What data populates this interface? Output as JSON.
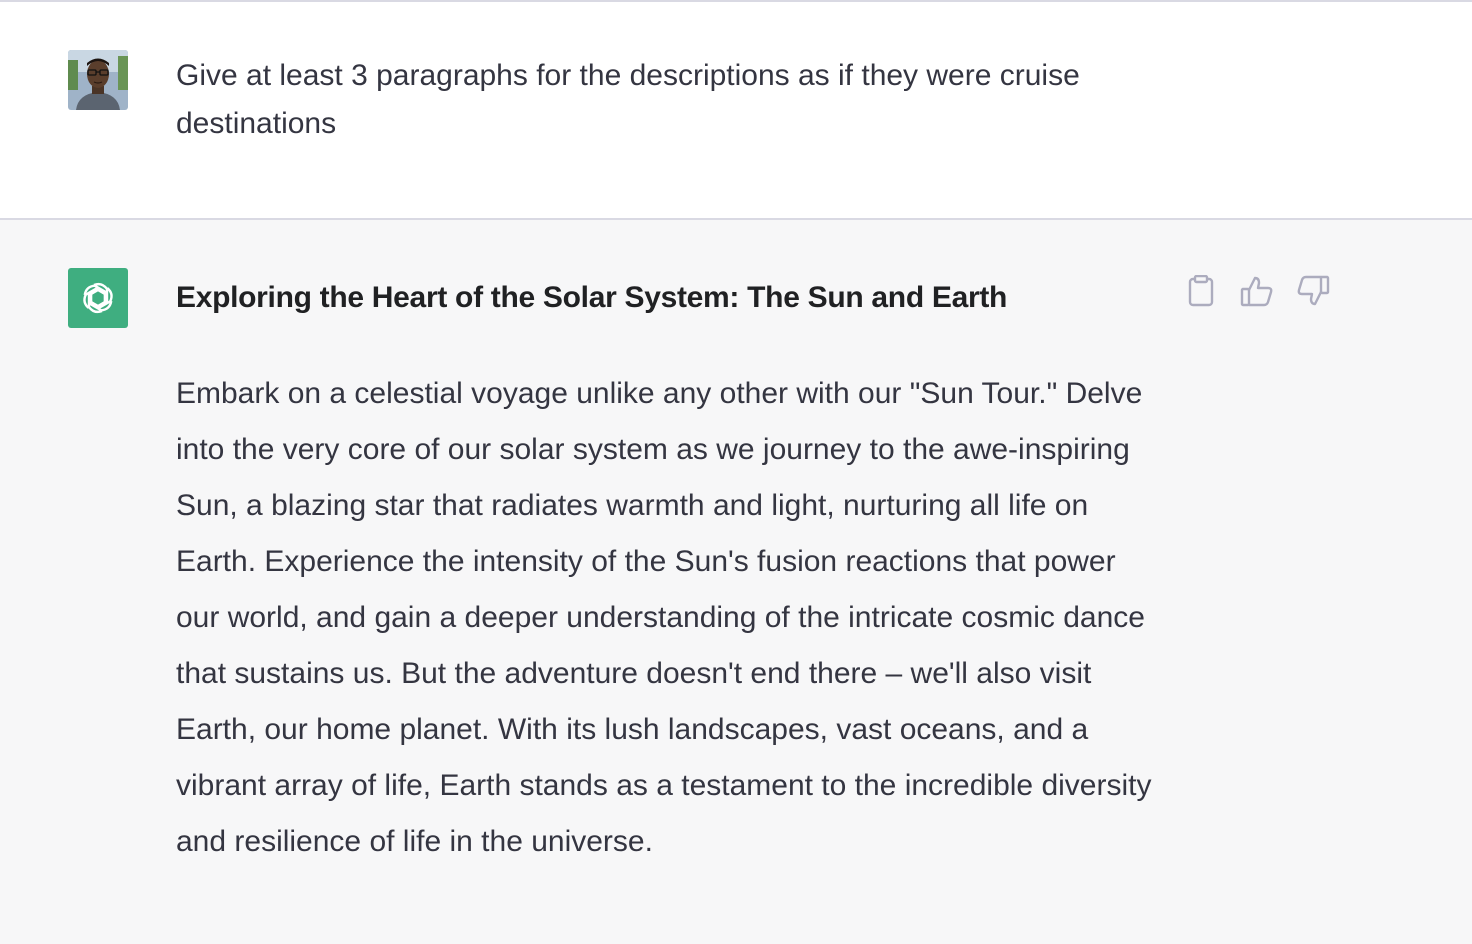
{
  "conversation": {
    "user_message": {
      "avatar_icon": "user-photo-avatar",
      "text": "Give at least 3 paragraphs for the descriptions as if they were cruise destinations"
    },
    "assistant_message": {
      "avatar_icon": "openai-logo-icon",
      "avatar_color": "#3fae80",
      "title": "Exploring the Heart of the Solar System: The Sun and Earth",
      "paragraphs": [
        "Embark on a celestial voyage unlike any other with our \"Sun Tour.\" Delve into the very core of our solar system as we journey to the awe-inspiring Sun, a blazing star that radiates warmth and light, nurturing all life on Earth. Experience the intensity of the Sun's fusion reactions that power our world, and gain a deeper understanding of the intricate cosmic dance that sustains us. But the adventure doesn't end there – we'll also visit Earth, our home planet. With its lush landscapes, vast oceans, and a vibrant array of life, Earth stands as a testament to the incredible diversity and resilience of life in the universe."
      ],
      "actions": [
        {
          "name": "copy",
          "icon": "clipboard-icon"
        },
        {
          "name": "thumbs-up",
          "icon": "thumbs-up-icon"
        },
        {
          "name": "thumbs-down",
          "icon": "thumbs-down-icon"
        }
      ]
    }
  },
  "colors": {
    "user_bg": "#ffffff",
    "assistant_bg": "#f7f7f8",
    "text": "#343541",
    "icon": "#acacbe"
  }
}
